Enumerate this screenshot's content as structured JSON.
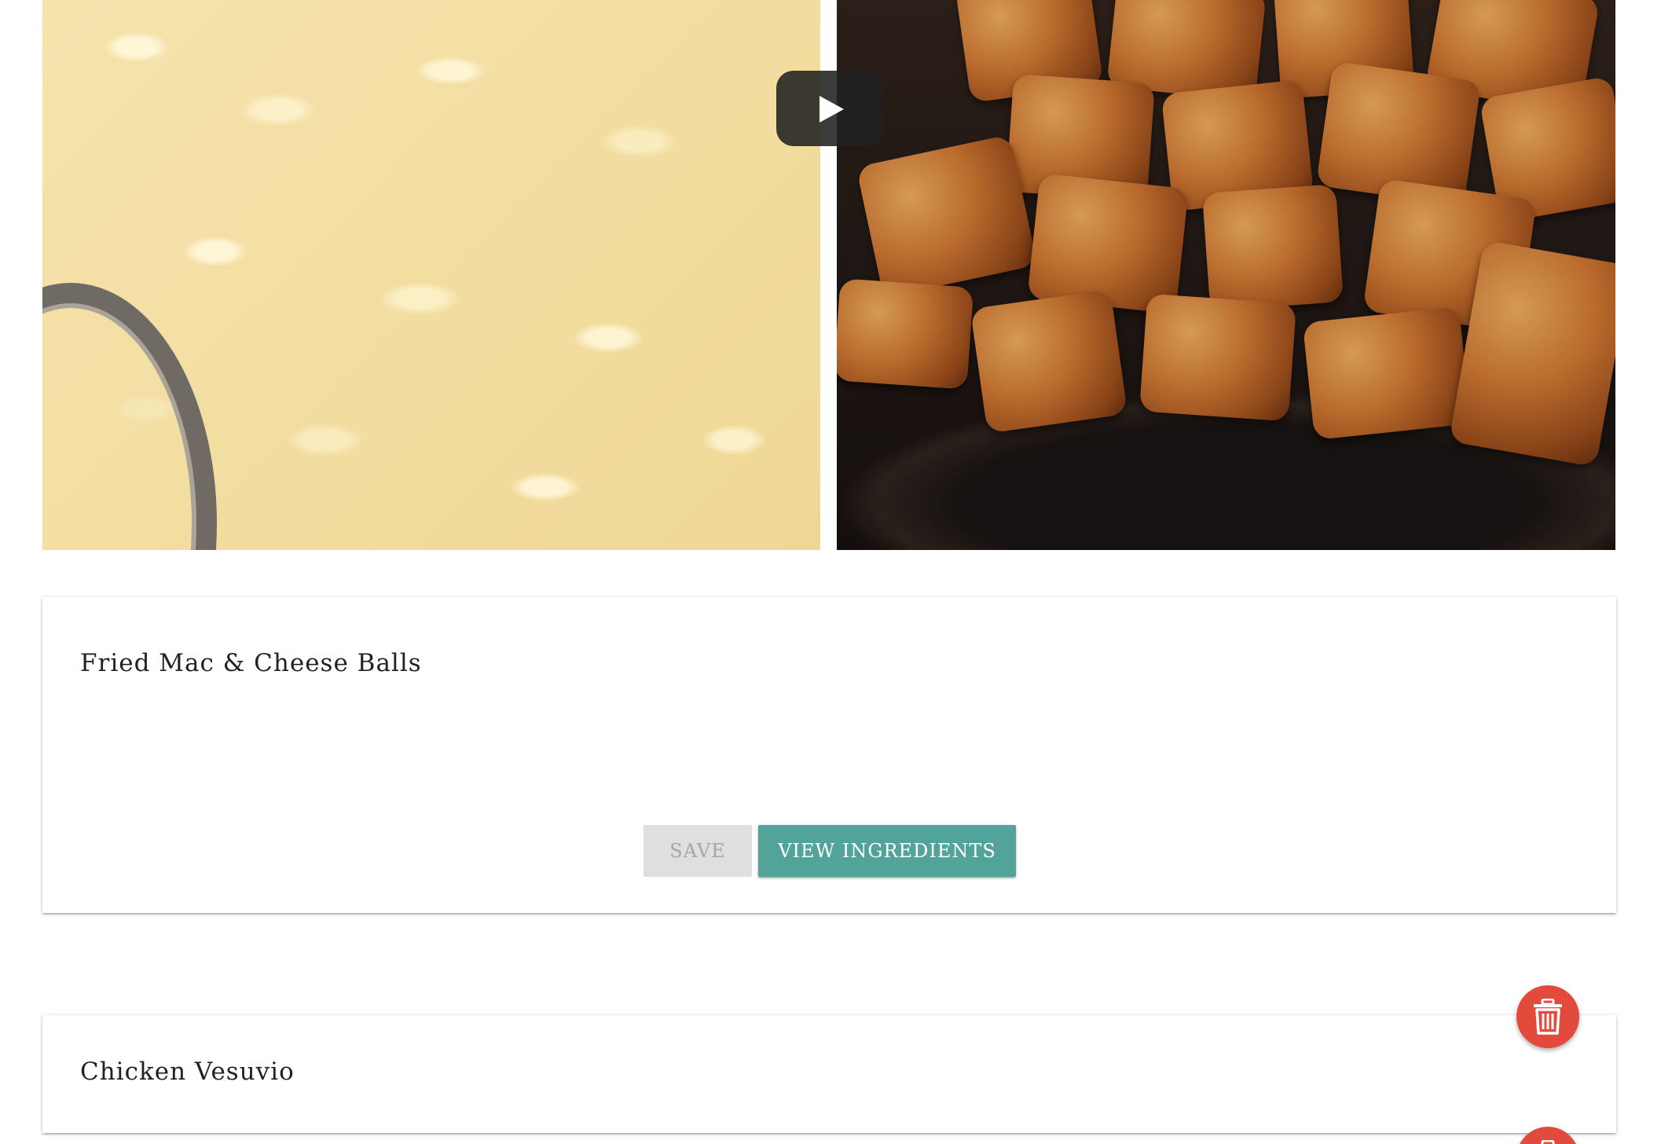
{
  "video": {
    "play_button_icon": "play-icon"
  },
  "recipes": [
    {
      "title": "Fried Mac & Cheese Balls",
      "save_label": "Save",
      "view_label": "View Ingredients",
      "delete_icon": "trash-icon"
    },
    {
      "title": "Chicken Vesuvio",
      "delete_icon": "trash-icon"
    }
  ],
  "colors": {
    "accent": "#52a49b",
    "delete": "#e24b3b",
    "disabled_bg": "#dfdfdf",
    "disabled_text": "#a6a6a6"
  }
}
